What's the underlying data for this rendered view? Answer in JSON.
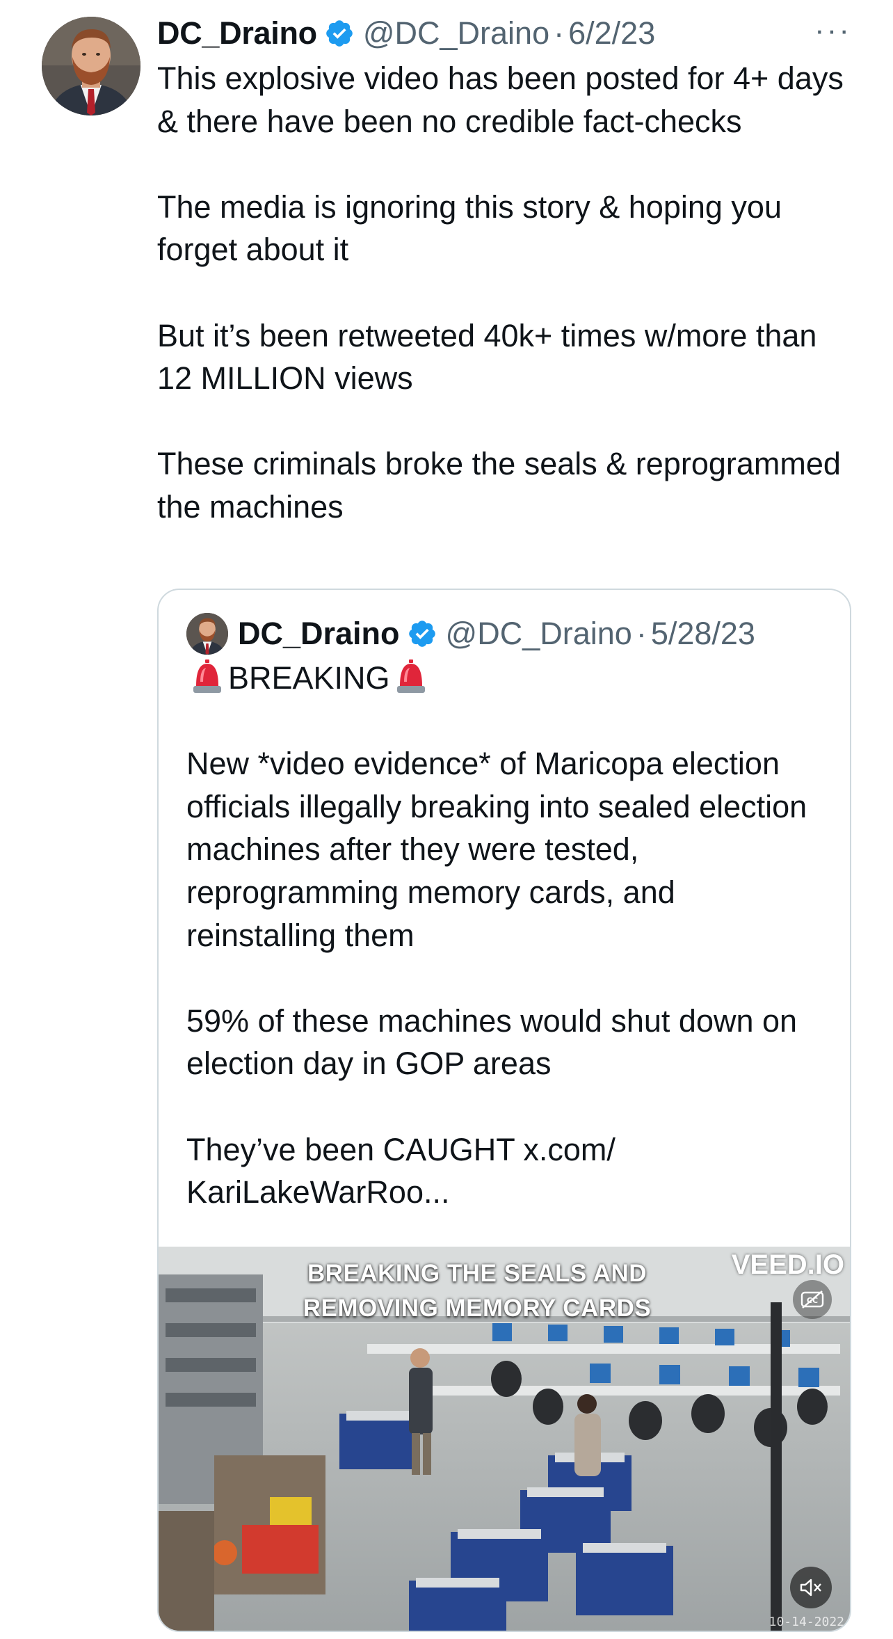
{
  "tweet": {
    "author_name": "DC_Draino",
    "handle": "@DC_Draino",
    "separator": "·",
    "date": "6/2/23",
    "more_label": "···",
    "paragraphs": [
      "This explosive video has been posted for 4+ days & there have been no credible fact-checks",
      "The media is ignoring this story & hoping you forget about it",
      "But it’s been retweeted 40k+ times w/more than 12 MILLION views",
      "These criminals broke the seals & reprogrammed the machines"
    ]
  },
  "quoted_tweet": {
    "author_name": "DC_Draino",
    "handle": "@DC_Draino",
    "separator": "·",
    "date": "5/28/23",
    "breaking_label": "BREAKING",
    "breaking_icon": "police-car-light-emoji",
    "paragraphs": [
      "New *video evidence* of Maricopa election officials illegally breaking into sealed election machines after they were tested, reprogramming memory cards, and reinstalling them",
      "59% of these machines would shut down on election day in GOP areas",
      "They’ve been CAUGHT x.com/ KariLakeWarRoo..."
    ],
    "video": {
      "caption_line1": "BREAKING THE SEALS AND",
      "caption_line2": "REMOVING MEMORY CARDS",
      "brand": "VEED.IO",
      "timestamp": "10-14-2022",
      "cc_icon": "closed-captions-off-icon",
      "mute_icon": "speaker-muted-icon"
    }
  },
  "colors": {
    "text": "#0f1419",
    "secondary": "#536471",
    "verified": "#1d9bf0",
    "border": "#cfd9de"
  }
}
